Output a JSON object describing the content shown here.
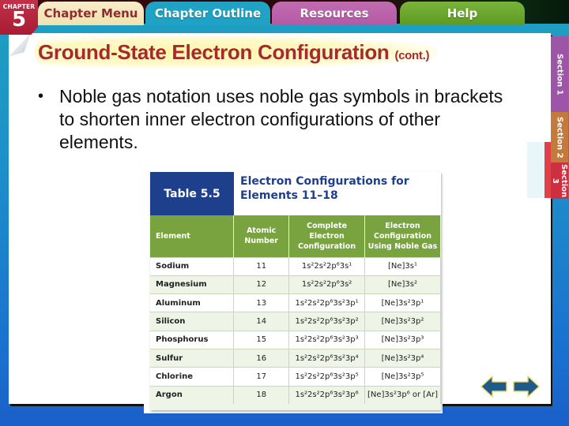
{
  "header": {
    "chapter_label": "CHAPTER",
    "chapter_number": "5",
    "tabs": [
      {
        "label": "Chapter Menu"
      },
      {
        "label": "Chapter Outline"
      },
      {
        "label": "Resources"
      },
      {
        "label": "Help"
      }
    ]
  },
  "section_tabs": [
    {
      "label": "Section 1"
    },
    {
      "label": "Section 2"
    },
    {
      "label": "Section 3"
    }
  ],
  "slide": {
    "title": "Ground-State Electron Configuration",
    "title_suffix": "(cont.)",
    "bullet": "Noble gas notation uses noble gas symbols in brackets to shorten inner electron configurations of other elements.",
    "table": {
      "number": "Table 5.5",
      "title_line1": "Electron Configurations for",
      "title_line2": "Elements 11–18",
      "columns": [
        "Element",
        "Atomic Number",
        "Complete Electron Configuration",
        "Electron Configuration Using Noble Gas"
      ],
      "rows": [
        {
          "element": "Sodium",
          "atomic_number": "11",
          "complete": "1s²2s²2p⁶3s¹",
          "noble_gas": "[Ne]3s¹"
        },
        {
          "element": "Magnesium",
          "atomic_number": "12",
          "complete": "1s²2s²2p⁶3s²",
          "noble_gas": "[Ne]3s²"
        },
        {
          "element": "Aluminum",
          "atomic_number": "13",
          "complete": "1s²2s²2p⁶3s²3p¹",
          "noble_gas": "[Ne]3s²3p¹"
        },
        {
          "element": "Silicon",
          "atomic_number": "14",
          "complete": "1s²2s²2p⁶3s²3p²",
          "noble_gas": "[Ne]3s²3p²"
        },
        {
          "element": "Phosphorus",
          "atomic_number": "15",
          "complete": "1s²2s²2p⁶3s²3p³",
          "noble_gas": "[Ne]3s²3p³"
        },
        {
          "element": "Sulfur",
          "atomic_number": "16",
          "complete": "1s²2s²2p⁶3s²3p⁴",
          "noble_gas": "[Ne]3s²3p⁴"
        },
        {
          "element": "Chlorine",
          "atomic_number": "17",
          "complete": "1s²2s²2p⁶3s²3p⁵",
          "noble_gas": "[Ne]3s²3p⁵"
        },
        {
          "element": "Argon",
          "atomic_number": "18",
          "complete": "1s²2s²2p⁶3s²3p⁶",
          "noble_gas": "[Ne]3s²3p⁶ or [Ar]"
        }
      ]
    }
  },
  "navigation": {
    "back_icon": "arrow-left-icon",
    "forward_icon": "arrow-right-icon"
  },
  "colors": {
    "title": "#a52a2f",
    "table_number_bg": "#1e3f8c",
    "table_header_bg": "#79a33e",
    "tab_menu": "#f0e2b0",
    "tab_outline": "#1fa2c4",
    "tab_resources": "#b45aa5",
    "tab_help": "#5e9a22",
    "section1": "#9d55a8",
    "section2": "#c47a3a",
    "section3": "#cc3040",
    "arrow": "#1e5a8c"
  }
}
